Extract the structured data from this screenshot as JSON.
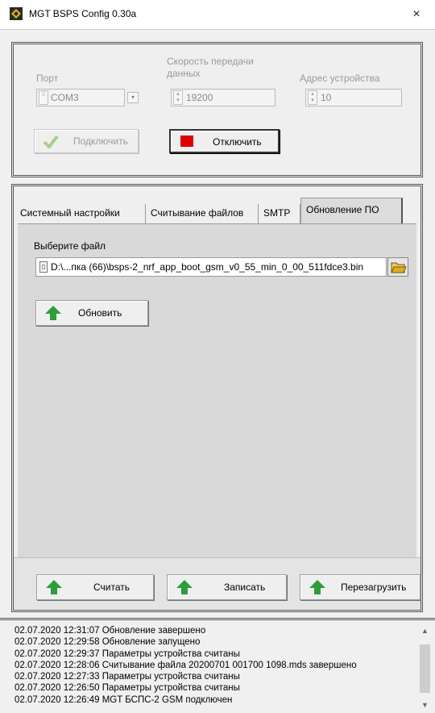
{
  "window": {
    "title": "MGT BSPS Config 0.30a",
    "close_glyph": "×"
  },
  "connection": {
    "port_label": "Порт",
    "port_value": "COM3",
    "baud_label_line1": "Скорость передачи",
    "baud_label_line2": "данных",
    "baud_value": "19200",
    "address_label": "Адрес устройства",
    "address_value": "10",
    "connect_label": "Подключить",
    "disconnect_label": "Отключить"
  },
  "tabs": [
    {
      "label": "Системный настройки"
    },
    {
      "label": "Считывание файлов"
    },
    {
      "label": "SMTP"
    },
    {
      "label": "Обновление ПО",
      "active": true
    }
  ],
  "update_tab": {
    "file_label": "Выберите файл",
    "file_path": "D:\\...пка (66)\\bsps-2_nrf_app_boot_gsm_v0_55_min_0_00_511fdce3.bin",
    "update_button": "Обновить"
  },
  "actions": {
    "read_label": "Считать",
    "write_label": "Записать",
    "reboot_label": "Перезагрузить"
  },
  "log": [
    "02.07.2020 12:31:07 Обновление завершено",
    "02.07.2020 12:29:58 Обновление запущено",
    "02.07.2020 12:29:37 Параметры устройства считаны",
    "02.07.2020 12:28:06 Считывание файла 20200701 001700 1098.mds завершено",
    "02.07.2020 12:27:33 Параметры устройства считаны",
    "02.07.2020 12:26:50 Параметры устройства считаны",
    "02.07.2020 12:26:49 MGT БСПС-2 GSM подключен"
  ],
  "colors": {
    "accent_green": "#2e9e3c",
    "stop_red": "#e00000"
  },
  "icons": [
    "app-icon",
    "close-icon",
    "checkmark-icon",
    "stop-icon",
    "up-arrow-icon",
    "folder-icon",
    "path-icon"
  ]
}
